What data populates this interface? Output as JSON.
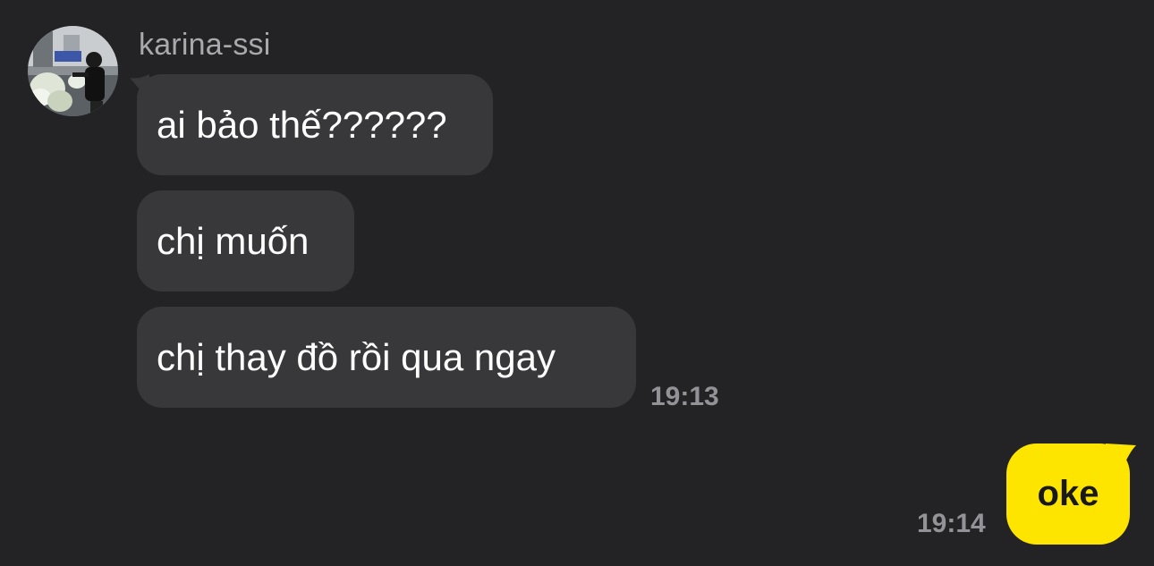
{
  "conversation": {
    "sender": {
      "name": "karina-ssi"
    },
    "incoming": [
      {
        "text": "ai bảo thế??????"
      },
      {
        "text": "chị muốn"
      },
      {
        "text": "chị thay đồ rồi qua ngay"
      }
    ],
    "incoming_time": "19:13",
    "outgoing": [
      {
        "text": "oke"
      }
    ],
    "outgoing_time": "19:14"
  },
  "colors": {
    "background": "#232325",
    "incoming_bubble": "#38383b",
    "outgoing_bubble": "#fee500",
    "incoming_text": "#ffffff",
    "outgoing_text": "#191919",
    "meta_text": "#939397"
  }
}
